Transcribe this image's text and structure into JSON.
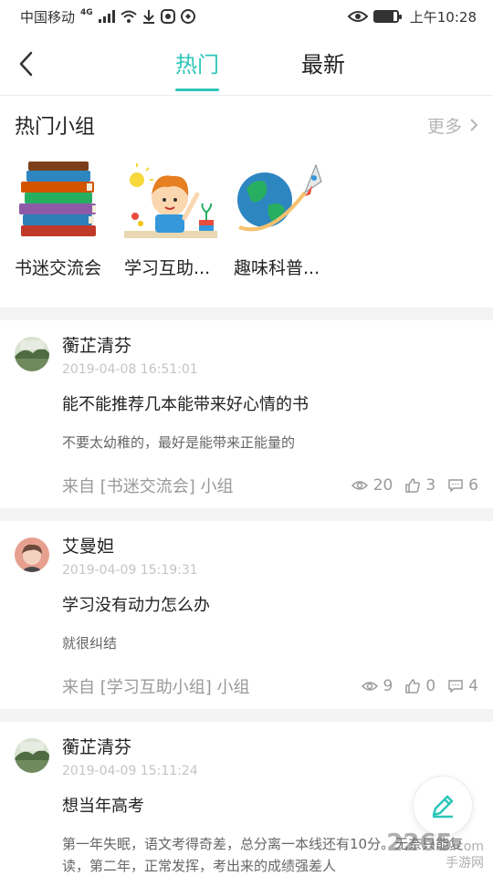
{
  "status_bar": {
    "carrier": "中国移动",
    "network": "4G",
    "time": "上午10:28",
    "battery_level": 0.85
  },
  "header": {
    "tabs": [
      {
        "label": "热门",
        "active": true
      },
      {
        "label": "最新",
        "active": false
      }
    ]
  },
  "hot_groups": {
    "title": "热门小组",
    "more_label": "更多",
    "groups": [
      {
        "name": "书迷交流会",
        "icon": "books-stack"
      },
      {
        "name": "学习互助...",
        "icon": "student-reading"
      },
      {
        "name": "趣味科普...",
        "icon": "earth-rocket"
      }
    ]
  },
  "posts": [
    {
      "author": "蘅芷清芬",
      "time": "2019-04-08 16:51:01",
      "title": "能不能推荐几本能带来好心情的书",
      "content": "不要太幼稚的，最好是能带来正能量的",
      "source": "来自 [书迷交流会] 小组",
      "views": "20",
      "likes": "3",
      "comments": "6"
    },
    {
      "author": "艾曼妲",
      "time": "2019-04-09 15:19:31",
      "title": "学习没有动力怎么办",
      "content": "就很纠结",
      "source": "来自 [学习互助小组] 小组",
      "views": "9",
      "likes": "0",
      "comments": "4"
    },
    {
      "author": "蘅芷清芬",
      "time": "2019-04-09 15:11:24",
      "title": "想当年高考",
      "content": "第一年失眠，语文考得奇差，总分离一本线还有10分。无奈只能复读，第二年，正常发挥，考出来的成绩强差人",
      "source": "",
      "views": "",
      "likes": "",
      "comments": ""
    }
  ],
  "watermark": {
    "brand": "2265",
    "suffix": ".com",
    "subtitle": "手游网"
  },
  "colors": {
    "accent": "#2cc6b9",
    "muted": "#999999",
    "gap": "#f3f3f3"
  }
}
